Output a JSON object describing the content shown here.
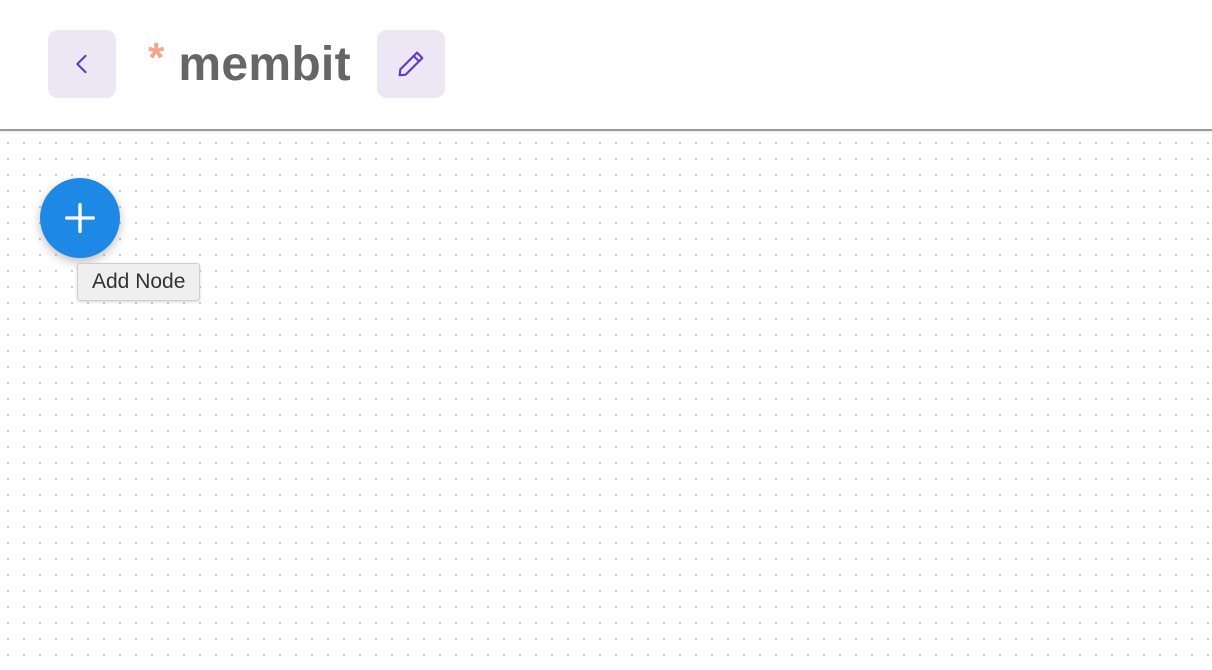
{
  "header": {
    "title": "membit",
    "unsaved_marker": "*",
    "back_icon": "chevron-left-icon",
    "edit_icon": "pencil-icon"
  },
  "canvas": {
    "add_node_icon": "plus-icon",
    "add_node_tooltip": "Add Node"
  },
  "colors": {
    "icon_button_bg": "#ede6f5",
    "icon_color": "#5b3cc4",
    "unsaved_marker": "#f4a58a",
    "fab_bg": "#1e88e5",
    "fab_icon": "#ffffff"
  }
}
